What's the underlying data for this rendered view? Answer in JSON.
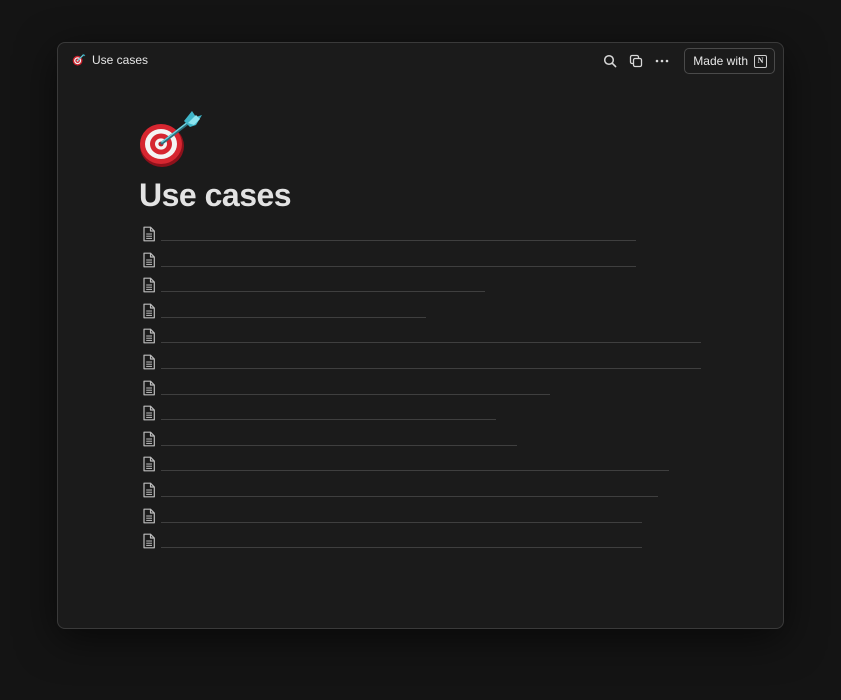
{
  "breadcrumb": {
    "label": "Use cases",
    "icon": "dart-target-icon"
  },
  "toolbar": {
    "made_with_label": "Made with",
    "brand_glyph": "N",
    "icons": [
      "search-icon",
      "duplicate-icon",
      "more-icon"
    ]
  },
  "page": {
    "title": "Use cases",
    "icon": "dart-target-icon"
  },
  "items": [
    {
      "label": "",
      "ratio": 0.88
    },
    {
      "label": "",
      "ratio": 0.88
    },
    {
      "label": "",
      "ratio": 0.6
    },
    {
      "label": "",
      "ratio": 0.49
    },
    {
      "label": "",
      "ratio": 1.0
    },
    {
      "label": "",
      "ratio": 1.0
    },
    {
      "label": "",
      "ratio": 0.72
    },
    {
      "label": "",
      "ratio": 0.62
    },
    {
      "label": "",
      "ratio": 0.66
    },
    {
      "label": "",
      "ratio": 0.94
    },
    {
      "label": "",
      "ratio": 0.92
    },
    {
      "label": "",
      "ratio": 0.89
    },
    {
      "label": "",
      "ratio": 0.89
    }
  ],
  "colors": {
    "background": "#141414",
    "window": "#1b1b1b",
    "text": "#e3e3e3",
    "divider": "#3f3f3f"
  }
}
